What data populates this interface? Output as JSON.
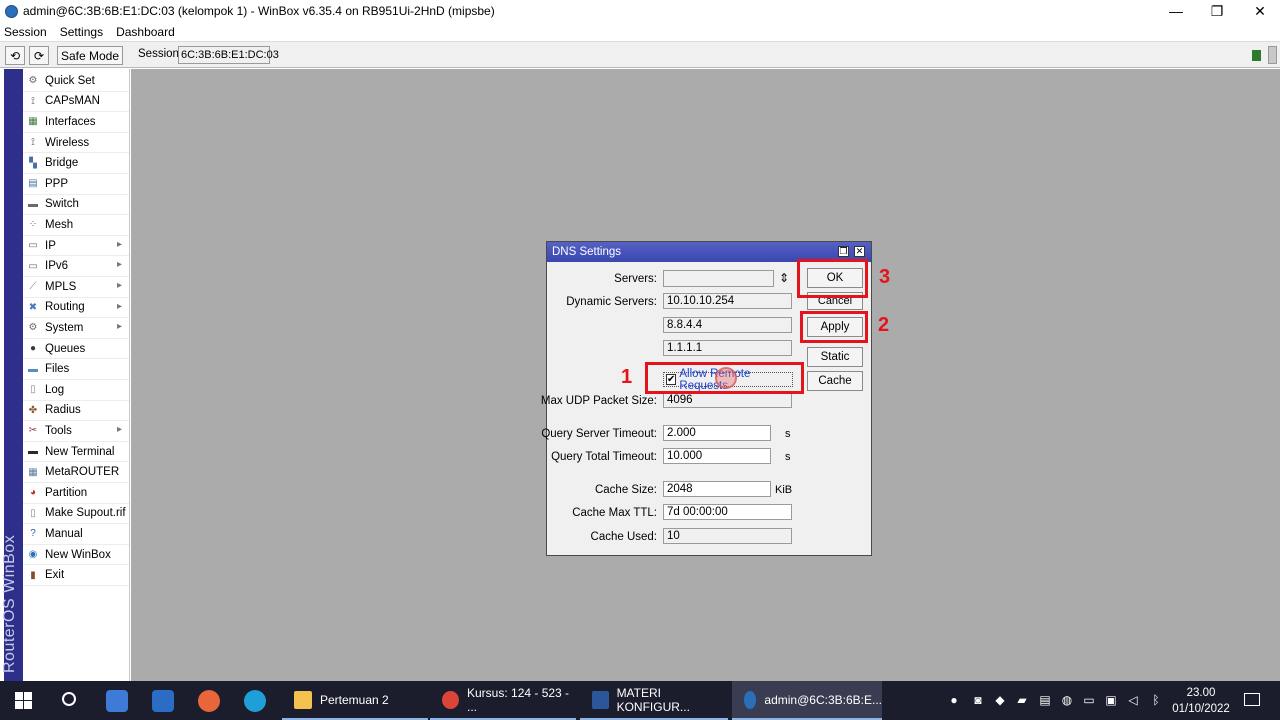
{
  "window": {
    "title": "admin@6C:3B:6B:E1:DC:03 (kelompok 1) - WinBox v6.35.4 on RB951Ui-2HnD (mipsbe)",
    "controls": {
      "minimize": "—",
      "maximize": "❐",
      "close": "✕"
    }
  },
  "menu": [
    "Session",
    "Settings",
    "Dashboard"
  ],
  "toolbar": {
    "undo_icon": "⟲",
    "redo_icon": "⟳",
    "safe_mode": "Safe Mode",
    "session_label": "Session:",
    "session_value": "6C:3B:6B:E1:DC:03"
  },
  "brand": "RouterOS WinBox",
  "sidebar": [
    {
      "label": "Quick Set",
      "icon": "quickset-icon",
      "glyph": "⚙",
      "color": "#5a6a7a",
      "sub": false
    },
    {
      "label": "CAPsMAN",
      "icon": "antenna-icon",
      "glyph": "⟟",
      "color": "#555555",
      "sub": false
    },
    {
      "label": "Interfaces",
      "icon": "interfaces-icon",
      "glyph": "▦",
      "color": "#3a7a3a",
      "sub": false
    },
    {
      "label": "Wireless",
      "icon": "antenna-icon",
      "glyph": "⟟",
      "color": "#555555",
      "sub": false
    },
    {
      "label": "Bridge",
      "icon": "bridge-icon",
      "glyph": "▚",
      "color": "#4a6fa5",
      "sub": false
    },
    {
      "label": "PPP",
      "icon": "ppp-icon",
      "glyph": "▤",
      "color": "#4a6fa5",
      "sub": false
    },
    {
      "label": "Switch",
      "icon": "switch-icon",
      "glyph": "▬",
      "color": "#6a6a6a",
      "sub": false
    },
    {
      "label": "Mesh",
      "icon": "mesh-icon",
      "glyph": "⁘",
      "color": "#4a6fa5",
      "sub": false
    },
    {
      "label": "IP",
      "icon": "ip-icon",
      "glyph": "▭",
      "color": "#6a6a6a",
      "sub": true
    },
    {
      "label": "IPv6",
      "icon": "ipv6-icon",
      "glyph": "▭",
      "color": "#6a6a6a",
      "sub": true
    },
    {
      "label": "MPLS",
      "icon": "mpls-icon",
      "glyph": "⟋",
      "color": "#6a7aa0",
      "sub": true
    },
    {
      "label": "Routing",
      "icon": "routing-icon",
      "glyph": "✖",
      "color": "#4a7ac0",
      "sub": true
    },
    {
      "label": "System",
      "icon": "system-icon",
      "glyph": "⚙",
      "color": "#6a6a6a",
      "sub": true
    },
    {
      "label": "Queues",
      "icon": "queues-icon",
      "glyph": "●",
      "color": "#3a3a3a",
      "sub": false
    },
    {
      "label": "Files",
      "icon": "files-icon",
      "glyph": "▬",
      "color": "#5a8ac0",
      "sub": false
    },
    {
      "label": "Log",
      "icon": "log-icon",
      "glyph": "▯",
      "color": "#8a8a8a",
      "sub": false
    },
    {
      "label": "Radius",
      "icon": "radius-icon",
      "glyph": "✤",
      "color": "#8a5a2a",
      "sub": false
    },
    {
      "label": "Tools",
      "icon": "tools-icon",
      "glyph": "✂",
      "color": "#8a3a2a",
      "sub": true
    },
    {
      "label": "New Terminal",
      "icon": "terminal-icon",
      "glyph": "▬",
      "color": "#2a2a2a",
      "sub": false
    },
    {
      "label": "MetaROUTER",
      "icon": "metarouter-icon",
      "glyph": "▦",
      "color": "#5a7aa0",
      "sub": false
    },
    {
      "label": "Partition",
      "icon": "partition-icon",
      "glyph": "◕",
      "color": "#c03030",
      "sub": false
    },
    {
      "label": "Make Supout.rif",
      "icon": "supout-icon",
      "glyph": "▯",
      "color": "#8a8a8a",
      "sub": false
    },
    {
      "label": "Manual",
      "icon": "manual-icon",
      "glyph": "?",
      "color": "#2a5ab0",
      "sub": false
    },
    {
      "label": "New WinBox",
      "icon": "winbox-icon",
      "glyph": "◉",
      "color": "#2a6fb8",
      "sub": false
    },
    {
      "label": "Exit",
      "icon": "exit-icon",
      "glyph": "▮",
      "color": "#8a4a2a",
      "sub": false
    }
  ],
  "sidebar_arrow": "▸",
  "dns": {
    "title": "DNS Settings",
    "restore_glyph": "❐",
    "close_glyph": "✕",
    "servers_label": "Servers:",
    "servers_value": "",
    "servers_spin": "⇕",
    "dynamic_label": "Dynamic Servers:",
    "dynamic_servers": [
      "10.10.10.254",
      "8.8.4.4",
      "1.1.1.1"
    ],
    "allow_remote_label": "Allow Remote Requests",
    "allow_remote_checked": "✔",
    "max_udp_label": "Max UDP Packet Size:",
    "max_udp_value": "4096",
    "qs_timeout_label": "Query Server Timeout:",
    "qs_timeout_value": "2.000",
    "qt_timeout_label": "Query Total Timeout:",
    "qt_timeout_value": "10.000",
    "unit_s": "s",
    "cache_size_label": "Cache Size:",
    "cache_size_value": "2048",
    "unit_kib": "KiB",
    "cache_ttl_label": "Cache Max TTL:",
    "cache_ttl_value": "7d 00:00:00",
    "cache_used_label": "Cache Used:",
    "cache_used_value": "10",
    "buttons": {
      "ok": "OK",
      "cancel": "Cancel",
      "apply": "Apply",
      "static": "Static",
      "cache": "Cache"
    }
  },
  "annotations": {
    "step1": "1",
    "step2": "2",
    "step3": "3",
    "color": "#e3141c"
  },
  "taskbar": {
    "items": [
      {
        "label": "Pertemuan 2",
        "icon_color": "#f2c14e"
      },
      {
        "label": "Kursus: 124 - 523 - ...",
        "icon_color": "#db4437"
      },
      {
        "label": "MATERI KONFIGUR...",
        "icon_color": "#2b579a"
      },
      {
        "label": "admin@6C:3B:6B:E...",
        "icon_color": "#2a6fb8"
      }
    ],
    "time": "23.00",
    "date": "01/10/2022"
  }
}
